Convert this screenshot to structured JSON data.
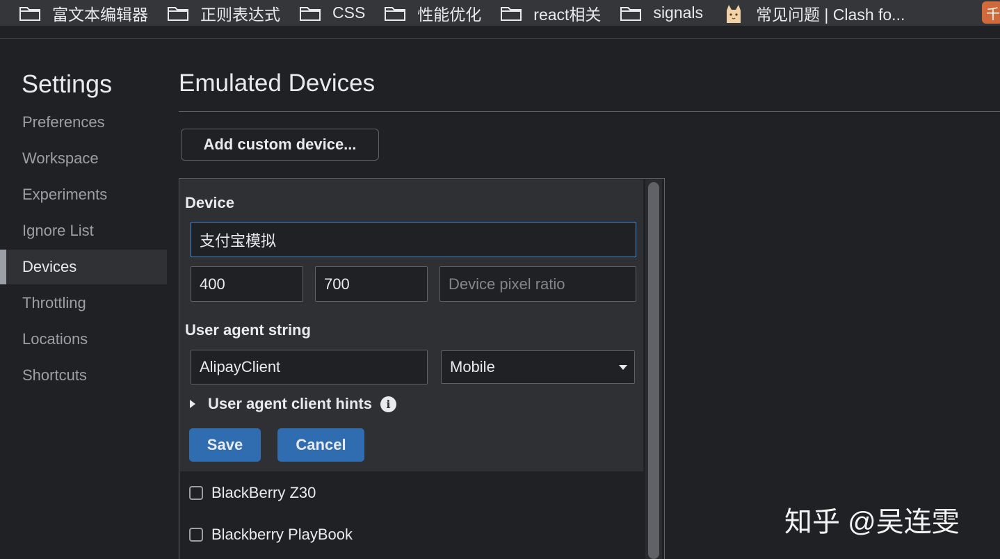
{
  "bookmarks": [
    {
      "label": "富文本编辑器",
      "icon": "folder-icon"
    },
    {
      "label": "正则表达式",
      "icon": "folder-icon"
    },
    {
      "label": "CSS",
      "icon": "folder-icon"
    },
    {
      "label": "性能优化",
      "icon": "folder-icon"
    },
    {
      "label": "react相关",
      "icon": "folder-icon"
    },
    {
      "label": "signals",
      "icon": "folder-icon"
    },
    {
      "label": "常见问题 | Clash fo...",
      "icon": "cat-favicon-icon"
    }
  ],
  "bookmark_edge_glyph": "千",
  "sidebar": {
    "title": "Settings",
    "items": [
      {
        "label": "Preferences"
      },
      {
        "label": "Workspace"
      },
      {
        "label": "Experiments"
      },
      {
        "label": "Ignore List"
      },
      {
        "label": "Devices",
        "active": true
      },
      {
        "label": "Throttling"
      },
      {
        "label": "Locations"
      },
      {
        "label": "Shortcuts"
      }
    ]
  },
  "main": {
    "title": "Emulated Devices",
    "add_button": "Add custom device...",
    "editor": {
      "device_label": "Device",
      "device_name": "支付宝模拟",
      "width": "400",
      "height": "700",
      "dpr_placeholder": "Device pixel ratio",
      "ua_label": "User agent string",
      "ua_value": "AlipayClient",
      "ua_type": "Mobile",
      "hints_label": "User agent client hints",
      "info_glyph": "i",
      "save": "Save",
      "cancel": "Cancel"
    },
    "devices": [
      {
        "name": "BlackBerry Z30",
        "checked": false
      },
      {
        "name": "Blackberry PlayBook",
        "checked": false
      }
    ]
  },
  "watermark": "知乎 @吴连雯"
}
